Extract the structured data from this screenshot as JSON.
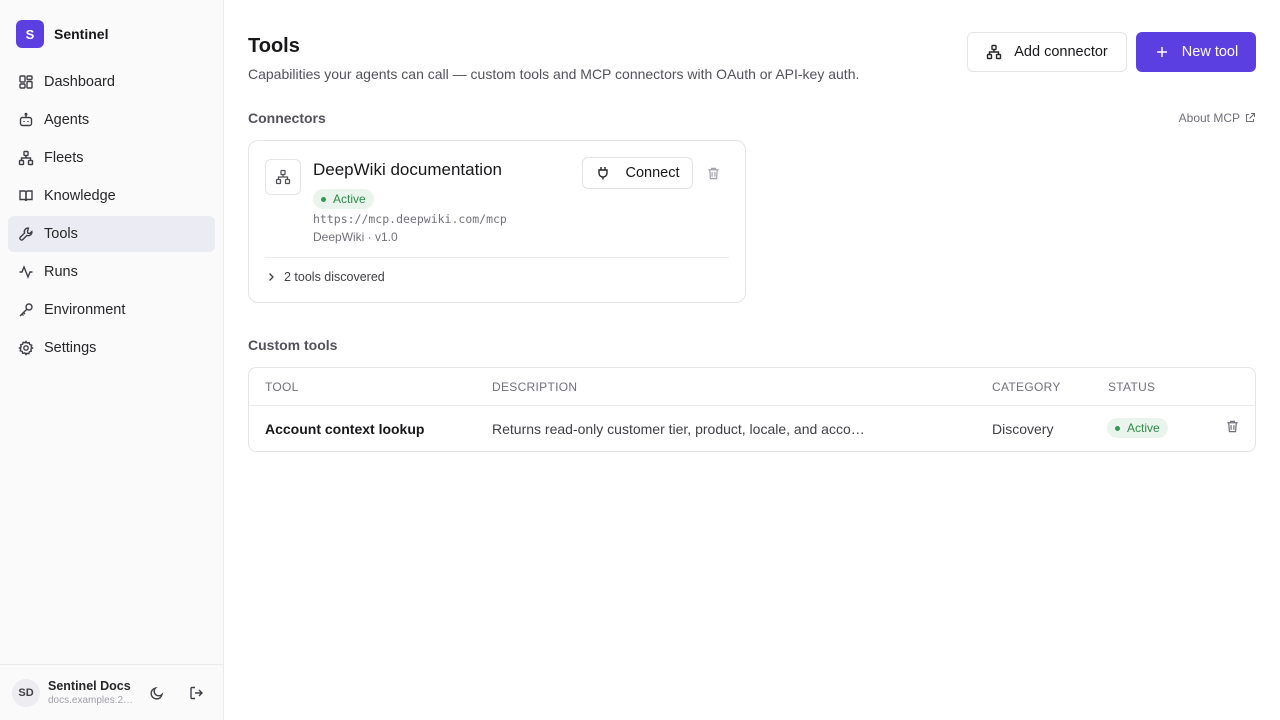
{
  "brand": {
    "logo_letter": "S",
    "name": "Sentinel",
    "accent": "#5b3fe0"
  },
  "nav": [
    {
      "label": "Dashboard",
      "icon": "dashboard-icon"
    },
    {
      "label": "Agents",
      "icon": "bot-icon"
    },
    {
      "label": "Fleets",
      "icon": "network-icon"
    },
    {
      "label": "Knowledge",
      "icon": "book-icon"
    },
    {
      "label": "Tools",
      "icon": "wrench-icon",
      "active": true
    },
    {
      "label": "Runs",
      "icon": "activity-icon"
    },
    {
      "label": "Environment",
      "icon": "key-icon"
    },
    {
      "label": "Settings",
      "icon": "gear-icon"
    }
  ],
  "user": {
    "initials": "SD",
    "name": "Sentinel Docs",
    "email": "docs.examples.2…"
  },
  "page": {
    "title": "Tools",
    "subtitle": "Capabilities your agents can call — custom tools and MCP connectors with OAuth or API-key auth."
  },
  "actions": {
    "add_connector": "Add connector",
    "new_tool": "New tool"
  },
  "connectors": {
    "section_title": "Connectors",
    "about_link": "About MCP",
    "items": [
      {
        "name": "DeepWiki documentation",
        "status": "Active",
        "url": "https://mcp.deepwiki.com/mcp",
        "version": "DeepWiki · v1.0",
        "connect_label": "Connect",
        "tools_discovered": "2 tools discovered"
      }
    ]
  },
  "custom_tools": {
    "section_title": "Custom tools",
    "columns": [
      "TOOL",
      "DESCRIPTION",
      "CATEGORY",
      "STATUS"
    ],
    "rows": [
      {
        "tool": "Account context lookup",
        "description": "Returns read-only customer tier, product, locale, and acco…",
        "category": "Discovery",
        "status": "Active"
      }
    ]
  },
  "colors": {
    "status_active": "#2f8a4a",
    "status_active_bg": "#e9f5ec"
  }
}
